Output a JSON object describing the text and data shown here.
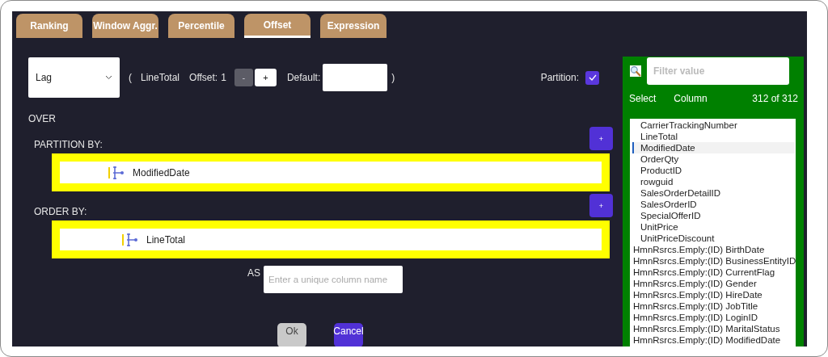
{
  "tabs": [
    {
      "label": "Ranking",
      "selected": false
    },
    {
      "label": "Window Aggr.",
      "selected": false
    },
    {
      "label": "Percentile",
      "selected": false
    },
    {
      "label": "Offset",
      "selected": true
    },
    {
      "label": "Expression",
      "selected": false
    }
  ],
  "function": {
    "value": "Lag"
  },
  "expression": {
    "open_paren": "(",
    "column": "LineTotal",
    "offset_label": "Offset:",
    "offset_value": "1",
    "minus": "-",
    "plus": "+",
    "default_label": "Default:",
    "close_paren": ")"
  },
  "partition": {
    "label": "Partition:",
    "checked": true
  },
  "over_label": "OVER",
  "partition_by": {
    "label": "PARTITION BY:",
    "add": "+",
    "items": [
      "ModifiedDate"
    ]
  },
  "order_by": {
    "label": "ORDER BY:",
    "add": "+",
    "items": [
      "LineTotal"
    ]
  },
  "alias": {
    "label": "AS",
    "placeholder": "Enter a unique column name"
  },
  "buttons": [
    {
      "label": "Ok",
      "kind": "secondary"
    },
    {
      "label": "Cancel",
      "kind": "primary"
    }
  ],
  "column_picker": {
    "filter_placeholder": "Filter value",
    "header_select": "Select",
    "header_column": "Column",
    "count": "312 of 312",
    "items": [
      {
        "label": "CarrierTrackingNumber",
        "kind": "column",
        "selected": false
      },
      {
        "label": "LineTotal",
        "kind": "column",
        "selected": false
      },
      {
        "label": "ModifiedDate",
        "kind": "column",
        "selected": true
      },
      {
        "label": "OrderQty",
        "kind": "column",
        "selected": false
      },
      {
        "label": "ProductID",
        "kind": "column",
        "selected": false
      },
      {
        "label": "rowguid",
        "kind": "column",
        "selected": false
      },
      {
        "label": "SalesOrderDetailID",
        "kind": "column",
        "selected": false
      },
      {
        "label": "SalesOrderID",
        "kind": "column",
        "selected": false
      },
      {
        "label": "SpecialOfferID",
        "kind": "column",
        "selected": false
      },
      {
        "label": "UnitPrice",
        "kind": "column",
        "selected": false
      },
      {
        "label": "UnitPriceDiscount",
        "kind": "column",
        "selected": false
      },
      {
        "label": "HmnRsrcs.Emply:(ID) BirthDate",
        "kind": "related",
        "selected": false
      },
      {
        "label": "HmnRsrcs.Emply:(ID) BusinessEntityID",
        "kind": "related",
        "selected": false
      },
      {
        "label": "HmnRsrcs.Emply:(ID) CurrentFlag",
        "kind": "related",
        "selected": false
      },
      {
        "label": "HmnRsrcs.Emply:(ID) Gender",
        "kind": "related",
        "selected": false
      },
      {
        "label": "HmnRsrcs.Emply:(ID) HireDate",
        "kind": "related",
        "selected": false
      },
      {
        "label": "HmnRsrcs.Emply:(ID) JobTitle",
        "kind": "related",
        "selected": false
      },
      {
        "label": "HmnRsrcs.Emply:(ID) LoginID",
        "kind": "related",
        "selected": false
      },
      {
        "label": "HmnRsrcs.Emply:(ID) MaritalStatus",
        "kind": "related",
        "selected": false
      },
      {
        "label": "HmnRsrcs.Emply:(ID) ModifiedDate",
        "kind": "related",
        "selected": false
      }
    ]
  }
}
